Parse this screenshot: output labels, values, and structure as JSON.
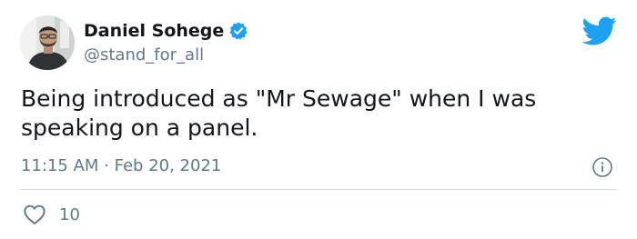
{
  "author": {
    "display_name": "Daniel Sohege",
    "handle": "@stand_for_all",
    "verified_icon": "verified-badge-icon"
  },
  "brand": {
    "icon": "twitter-bird-icon",
    "color": "#1da1f2"
  },
  "tweet": {
    "text": "Being introduced as \"Mr Sewage\" when I was speaking on a panel.",
    "timestamp": "11:15 AM · Feb 20, 2021"
  },
  "engagement": {
    "like_icon": "heart-icon",
    "like_count": "10",
    "info_icon": "info-icon"
  },
  "colors": {
    "text_primary": "#14171a",
    "text_secondary": "#657786",
    "divider": "#cfd9de"
  }
}
